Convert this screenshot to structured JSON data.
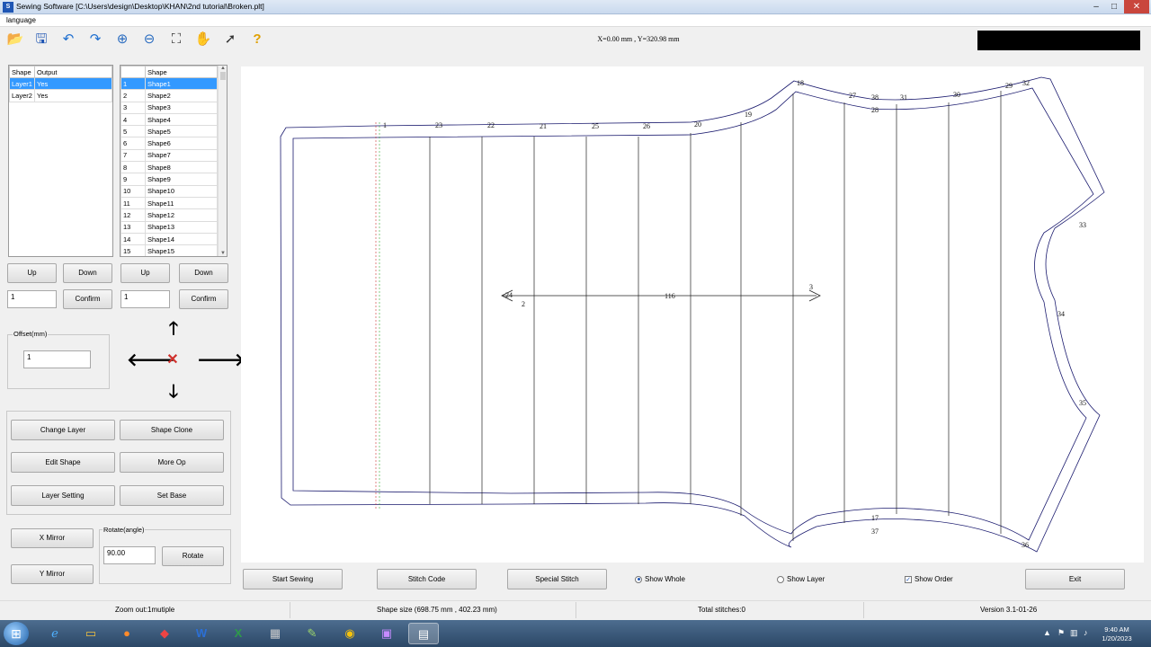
{
  "window": {
    "title": "Sewing Software   [C:\\Users\\design\\Desktop\\KHAN\\2nd tutorial\\Broken.plt]",
    "controls": {
      "minimize": "–",
      "maximize": "□",
      "close": "✕"
    }
  },
  "menu": {
    "items": [
      "language"
    ]
  },
  "toolbar": {
    "icons": [
      "open-folder-icon",
      "save-icon",
      "undo-icon",
      "redo-icon",
      "zoom-in-icon",
      "zoom-out-icon",
      "fit-window-icon",
      "pan-hand-icon",
      "select-arrow-icon",
      "help-icon"
    ],
    "coords": "X=0.00 mm , Y=320.98 mm"
  },
  "layer_table": {
    "headers": [
      "Shape",
      "Output"
    ],
    "rows": [
      [
        "Layer1",
        "Yes"
      ],
      [
        "Layer2",
        "Yes"
      ]
    ],
    "selected": 0
  },
  "shape_table": {
    "headers": [
      "",
      "Shape"
    ],
    "rows": [
      [
        "1",
        "Shape1"
      ],
      [
        "2",
        "Shape2"
      ],
      [
        "3",
        "Shape3"
      ],
      [
        "4",
        "Shape4"
      ],
      [
        "5",
        "Shape5"
      ],
      [
        "6",
        "Shape6"
      ],
      [
        "7",
        "Shape7"
      ],
      [
        "8",
        "Shape8"
      ],
      [
        "9",
        "Shape9"
      ],
      [
        "10",
        "Shape10"
      ],
      [
        "11",
        "Shape11"
      ],
      [
        "12",
        "Shape12"
      ],
      [
        "13",
        "Shape13"
      ],
      [
        "14",
        "Shape14"
      ],
      [
        "15",
        "Shape15"
      ]
    ],
    "selected": 0
  },
  "left_panel": {
    "up": "Up",
    "down": "Down",
    "confirm": "Confirm",
    "layer_index": "1",
    "shape_index": "1",
    "offset_label": "Offset(mm)",
    "offset_value": "1",
    "buttons": [
      "Change Layer",
      "Shape Clone",
      "Edit Shape",
      "More Op",
      "Layer Setting",
      "Set Base"
    ],
    "x_mirror": "X Mirror",
    "y_mirror": "Y Mirror",
    "rotate_label": "Rotate(angle)",
    "rotate_value": "90.00",
    "rotate": "Rotate",
    "arrows": {
      "up": "🡑",
      "down": "🡓",
      "left": "🡐",
      "right": "🡒",
      "center": "✕"
    }
  },
  "canvas": {
    "numbers_top": [
      "1",
      "23",
      "22",
      "21",
      "25",
      "26",
      "20",
      "19",
      "18",
      "27",
      "38",
      "31",
      "30",
      "29",
      "32",
      "28"
    ],
    "numbers_right": [
      "33",
      "34",
      "35",
      "36"
    ],
    "numbers_bottom": [
      "17",
      "37"
    ],
    "numbers_mid": [
      "24",
      "2",
      "3",
      "116"
    ]
  },
  "bottom_bar": {
    "start_sewing": "Start Sewing",
    "stitch_code": "Stitch Code",
    "special_stitch": "Special Stitch",
    "show_whole": "Show Whole",
    "show_layer": "Show Layer",
    "show_order": "Show Order",
    "exit": "Exit"
  },
  "status": {
    "zoom": "Zoom out:1mutiple",
    "shape_size": "Shape size (698.75 mm , 402.23 mm)",
    "total_stitches": "Total stitches:0",
    "version": "Version 3.1-01-26"
  },
  "taskbar": {
    "time": "9:40 AM",
    "date": "1/20/2023",
    "apps": [
      "ie-icon",
      "explorer-icon",
      "firefox-icon",
      "anydesk-icon",
      "word-icon",
      "excel-icon",
      "calculator-icon",
      "notepad-icon",
      "chrome-icon",
      "app-icon",
      "sewing-app-icon"
    ]
  },
  "colors": {
    "selection": "#3399ff",
    "close": "#c9463d",
    "taskbar": "#2b4766"
  }
}
